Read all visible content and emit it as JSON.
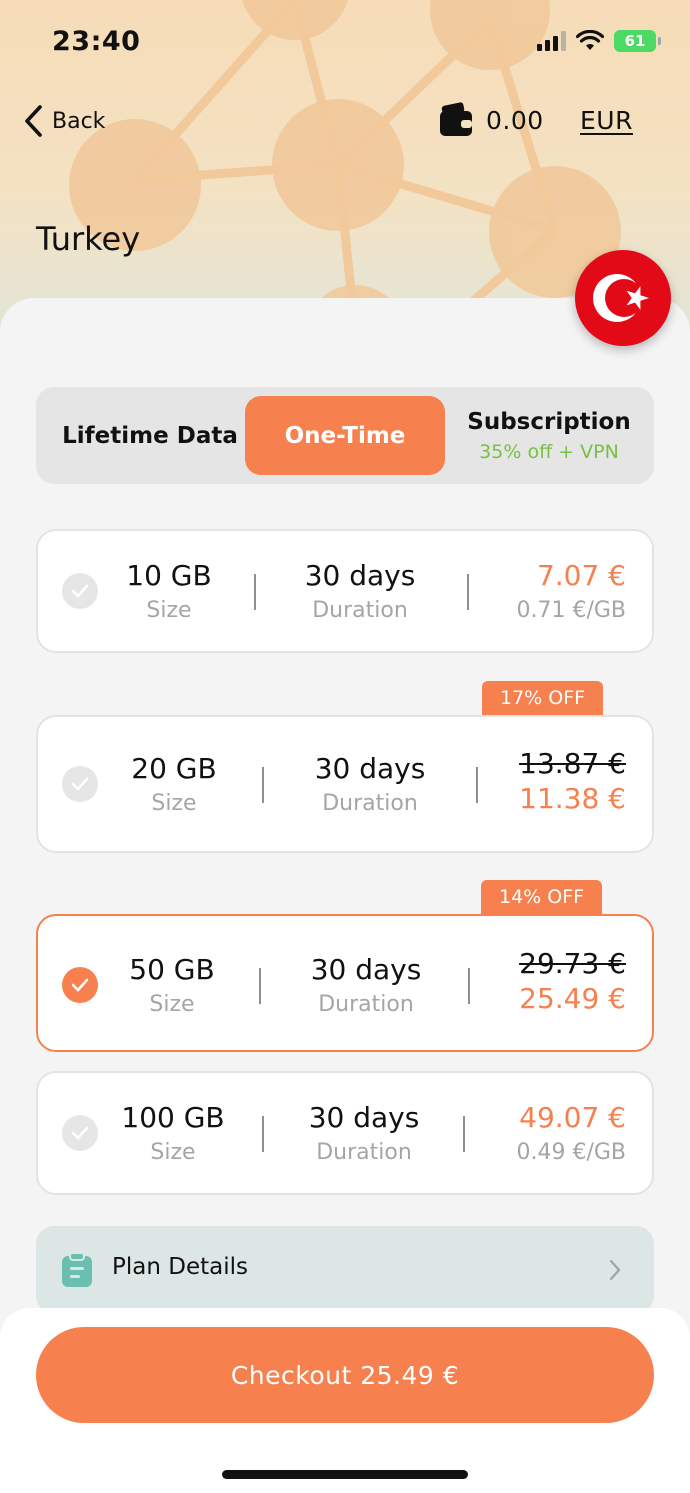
{
  "status_bar": {
    "time": "23:40",
    "battery": "61"
  },
  "header": {
    "back_label": "Back",
    "wallet_balance": "0.00",
    "currency": "EUR",
    "country": "Turkey"
  },
  "tabs": [
    {
      "label": "Lifetime Data",
      "active": false
    },
    {
      "label": "One-Time",
      "active": true
    },
    {
      "label": "Subscription",
      "sublabel": "35% off + VPN",
      "active": false
    }
  ],
  "plans": [
    {
      "size": "10 GB",
      "size_label": "Size",
      "duration": "30 days",
      "duration_label": "Duration",
      "price": "7.07 €",
      "per_gb": "0.71 €/GB",
      "selected": false
    },
    {
      "badge": "17% OFF",
      "size": "20 GB",
      "size_label": "Size",
      "duration": "30 days",
      "duration_label": "Duration",
      "old_price": "13.87 €",
      "price": "11.38 €",
      "selected": false
    },
    {
      "badge": "14% OFF",
      "size": "50 GB",
      "size_label": "Size",
      "duration": "30 days",
      "duration_label": "Duration",
      "old_price": "29.73 €",
      "price": "25.49 €",
      "selected": true
    },
    {
      "size": "100 GB",
      "size_label": "Size",
      "duration": "30 days",
      "duration_label": "Duration",
      "price": "49.07 €",
      "per_gb": "0.49 €/GB",
      "selected": false
    }
  ],
  "plan_details": {
    "label": "Plan Details"
  },
  "checkout": {
    "label": "Checkout 25.49 €"
  },
  "colors": {
    "accent": "#f7804f",
    "promo_green": "#77c043",
    "details_bg": "#dce7e5"
  }
}
